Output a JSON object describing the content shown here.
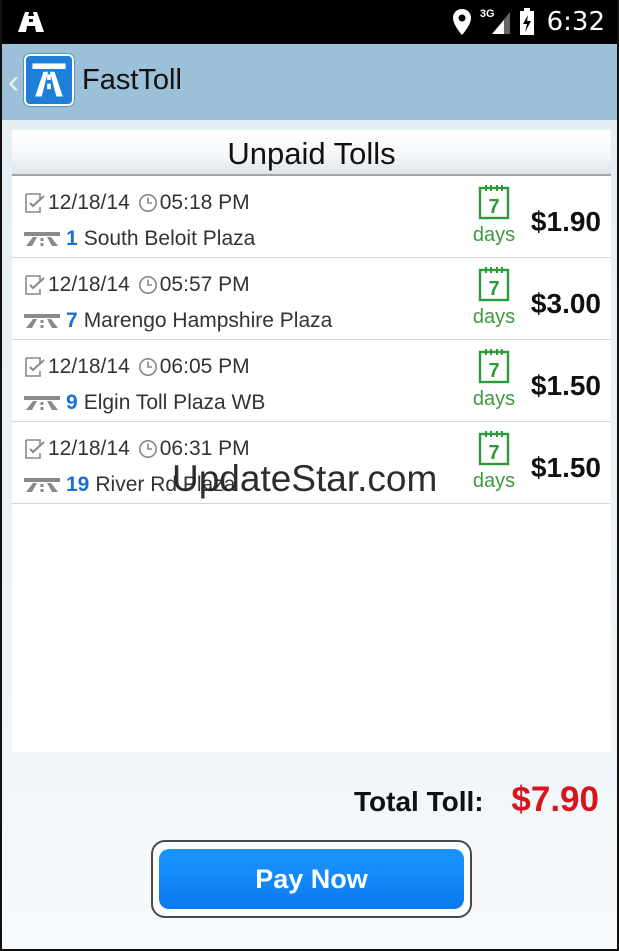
{
  "status_bar": {
    "time": "6:32",
    "network": "3G",
    "icons": [
      "notification-road-icon",
      "location-icon",
      "signal-icon",
      "battery-icon"
    ]
  },
  "action_bar": {
    "title": "FastToll",
    "icons": [
      "back-chevron-icon",
      "app-logo-icon"
    ]
  },
  "panel": {
    "title": "Unpaid Tolls"
  },
  "tolls": [
    {
      "date": "12/18/14",
      "time": "05:18 PM",
      "plaza_number": "1",
      "plaza_name": "South Beloit Plaza",
      "days": "7",
      "days_label": "days",
      "amount": "$1.90"
    },
    {
      "date": "12/18/14",
      "time": "05:57 PM",
      "plaza_number": "7",
      "plaza_name": "Marengo Hampshire Plaza",
      "days": "7",
      "days_label": "days",
      "amount": "$3.00"
    },
    {
      "date": "12/18/14",
      "time": "06:05 PM",
      "plaza_number": "9",
      "plaza_name": "Elgin Toll Plaza WB",
      "days": "7",
      "days_label": "days",
      "amount": "$1.50"
    },
    {
      "date": "12/18/14",
      "time": "06:31 PM",
      "plaza_number": "19",
      "plaza_name": "River Rd Plaza",
      "days": "7",
      "days_label": "days",
      "amount": "$1.50"
    }
  ],
  "watermark": "UpdateStar.com",
  "footer": {
    "total_label": "Total Toll:",
    "total_value": "$7.90",
    "pay_button": "Pay Now"
  },
  "colors": {
    "action_bar": "#9cc0d8",
    "accent_blue": "#0b7af0",
    "total_red": "#d8141e",
    "days_green": "#3f9a3f",
    "plaza_number_blue": "#1a6fd6"
  }
}
